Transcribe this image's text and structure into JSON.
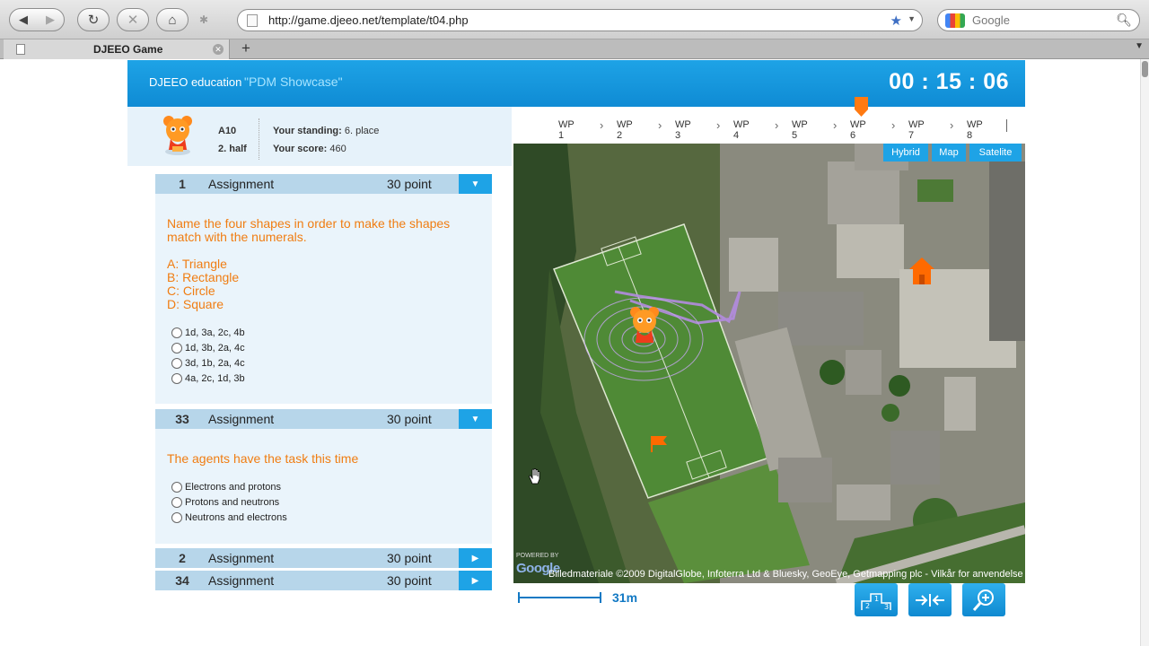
{
  "browser": {
    "url": "http://game.djeeo.net/template/t04.php",
    "search_placeholder": "Google",
    "tab_title": "DJEEO Game",
    "new_tab": "+"
  },
  "header": {
    "brand": "DJEEO education",
    "showcase": "\"PDM Showcase\"",
    "timer": "00 : 15 : 06"
  },
  "team": {
    "code": "A10",
    "half": "2. half",
    "standing_label": "Your standing:",
    "standing_value": "6. place",
    "score_label": "Your score:",
    "score_value": "460"
  },
  "waypoints": [
    "WP 1",
    "WP 2",
    "WP 3",
    "WP 4",
    "WP 5",
    "WP 6",
    "WP 7",
    "WP 8"
  ],
  "assignments": [
    {
      "number": "1",
      "title": "Assignment",
      "points": "30 point",
      "question_lines": [
        "Name the four shapes in order to make the shapes",
        "match with the numerals."
      ],
      "choices_text": [
        "A: Triangle",
        "B: Rectangle",
        "C: Circle",
        "D: Square"
      ],
      "options": [
        "1d, 3a, 2c, 4b",
        "1d, 3b, 2a, 4c",
        "3d, 1b, 2a, 4c",
        "4a, 2c, 1d, 3b"
      ]
    },
    {
      "number": "33",
      "title": "Assignment",
      "points": "30 point",
      "question_lines": [
        "The agents have the task this time"
      ],
      "options": [
        "Electrons and protons",
        "Protons and neutrons",
        "Neutrons and electrons"
      ]
    },
    {
      "number": "2",
      "title": "Assignment",
      "points": "30 point"
    },
    {
      "number": "34",
      "title": "Assignment",
      "points": "30 point"
    }
  ],
  "map": {
    "types": [
      "Hybrid",
      "Map",
      "Satelite"
    ],
    "copyright": "Billedmateriale ©2009 DigitalGlobe, Infoterra Ltd & Bluesky, GeoEye, Getmapping plc - Vilkår for anvendelse",
    "powered_by": "POWERED BY",
    "google_logo": "Google",
    "scale_label": "31m"
  },
  "colors": {
    "brand_blue": "#1ea3e6",
    "question_orange": "#f07d12",
    "assignment_bar": "#b7d6ea"
  }
}
